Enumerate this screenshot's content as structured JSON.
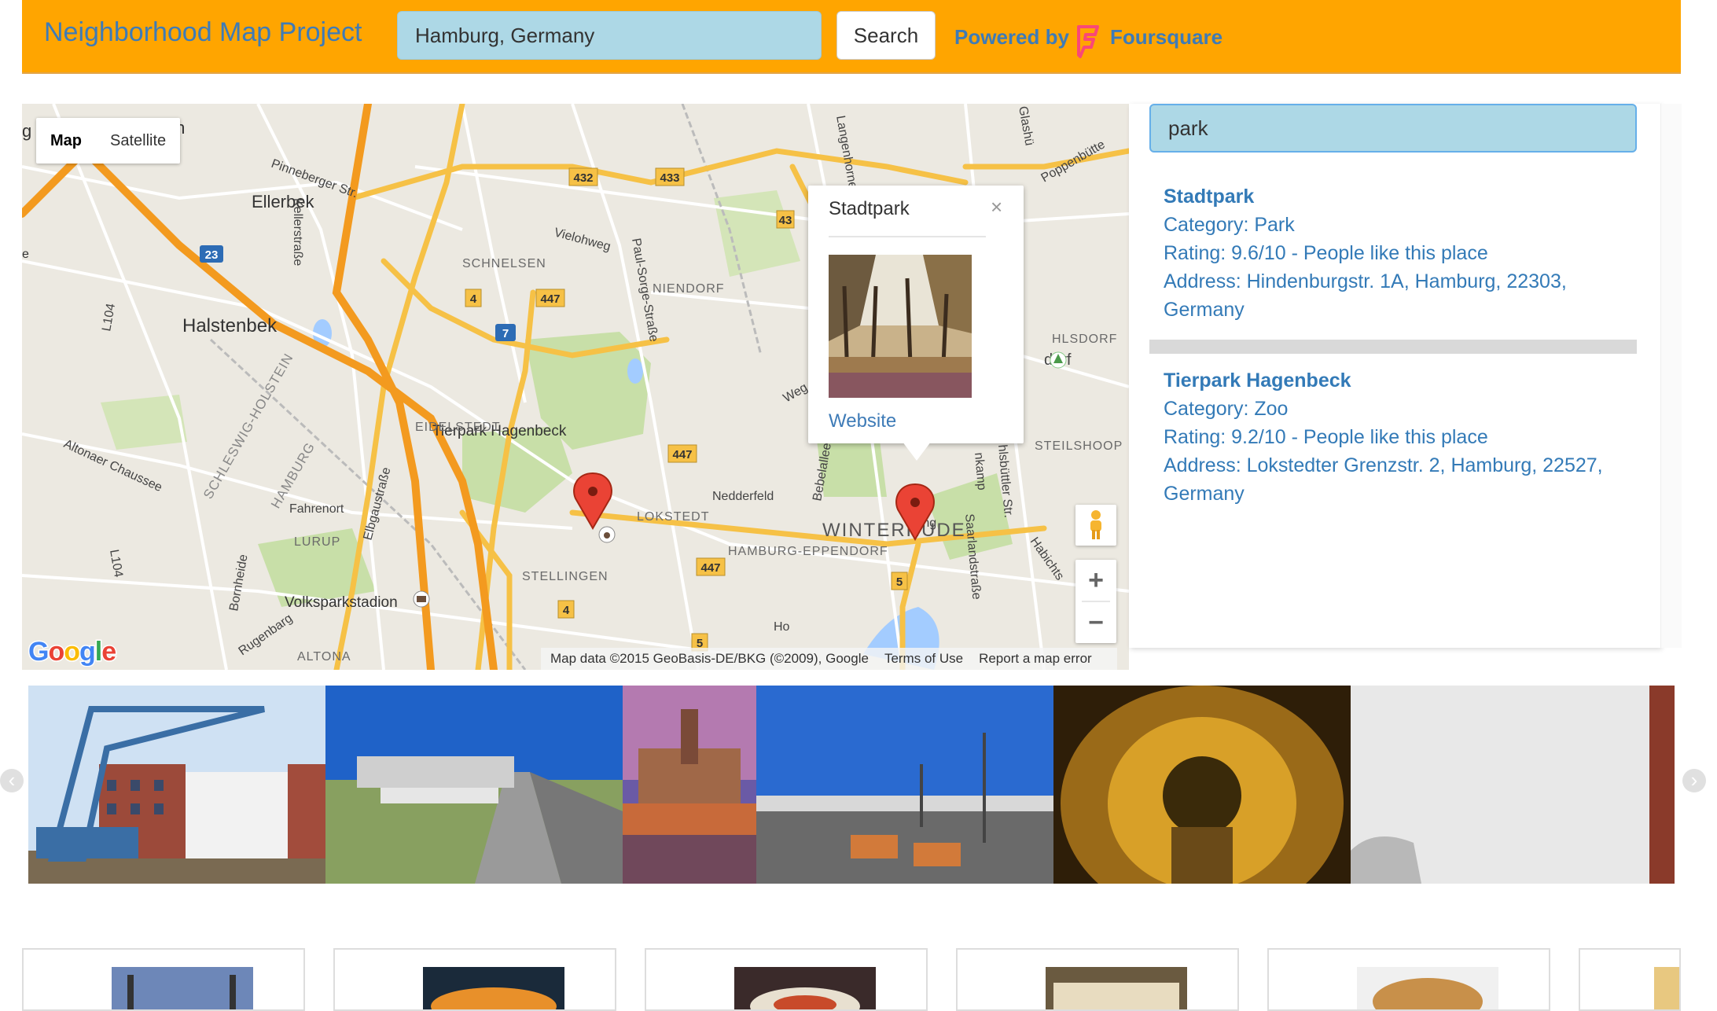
{
  "header": {
    "title": "Neighborhood Map Project",
    "location_value": "Hamburg, Germany",
    "search_label": "Search",
    "powered_by": "Powered by",
    "provider_name": "Foursquare",
    "bg_color": "#ffa500",
    "link_color": "#3e7bb7"
  },
  "map": {
    "type_buttons": [
      "Map",
      "Satellite"
    ],
    "selected_type": "Map",
    "labels": {
      "ellerbek": "Ellerbek",
      "halstenbek": "Halstenbek",
      "schnelsen": "SCHNELSEN",
      "niendorf": "NIENDORF",
      "eidelstedt": "EIDELSTEDT",
      "lokstedt": "LOKSTEDT",
      "stellingen": "STELLINGEN",
      "winterhude": "WINTERHUDE",
      "hamburg_eppendorf": "HAMBURG-EPPENDORF",
      "lurup": "LURUP",
      "altona": "ALTONA",
      "fahrenort": "Fahrenort",
      "tierpark": "Tierpark Hagenbeck",
      "volkspark": "Volksparkstadion",
      "nedderfeld": "Nedderfeld",
      "vielohweg": "Vielohweg",
      "pinneberger": "Pinneberger Str.",
      "kellerstrasse": "Kellerstraße",
      "paul_sorge": "Paul-Sorge-Straße",
      "langenhorner": "Langenhorner",
      "poppenbuttel": "Poppenbütte",
      "glashu": "Glashü",
      "ohlsdorf": "HLSDORF",
      "dorf": "dorf",
      "steilshoop": "STEILSHOOP",
      "altonaer": "Altonaer Chaussee",
      "schleswig": "SCHLESWIG-HOLSTEIN",
      "hamburg_state": "HAMBURG",
      "elbgau": "Elbgaustraße",
      "bornheide": "Bornheide",
      "rugenbarg": "Rugenbarg",
      "bebelallee": "Bebelallee",
      "saarland": "Saarlandstraße",
      "habichts": "Habichts",
      "fuhlsbuttler": "hlsbüttler Str.",
      "nkamp": "nkamp",
      "weg": "Weg",
      "jarrestadt": "Ja  ng",
      "l104a": "L104",
      "l104b": "L104",
      "jen": "jen",
      "g": "g",
      "e": "e",
      "ho": "Ho"
    },
    "road_shields": {
      "r432": "432",
      "r433": "433",
      "r43": "43",
      "r4a": "4",
      "r447a": "447",
      "r447b": "447",
      "r447c": "447",
      "r4b": "4",
      "r5a": "5",
      "r5b": "5",
      "a23": "23",
      "a7": "7"
    },
    "attribution": [
      "Map data ©2015 GeoBasis-DE/BKG (©2009), Google",
      "Terms of Use",
      "Report a map error"
    ],
    "google_logo": "Google",
    "zoom_in": "+",
    "zoom_out": "−"
  },
  "info_window": {
    "title": "Stadtpark",
    "close": "×",
    "link": "Website"
  },
  "sidebar": {
    "filter_value": "park",
    "venues": [
      {
        "name": "Stadtpark",
        "category": "Category: Park",
        "rating": "Rating: 9.6/10 - People like this place",
        "address_line1": "Address: Hindenburgstr. 1A, Hamburg, 22303,",
        "address_line2": "Germany"
      },
      {
        "name": "Tierpark Hagenbeck",
        "category": "Category: Zoo",
        "rating": "Rating: 9.2/10 - People like this place",
        "address_line1": "Address: Lokstedter Grenzstr. 2, Hamburg, 22527,",
        "address_line2": "Germany"
      }
    ]
  },
  "carousel": {
    "prev_icon": "‹",
    "next_icon": "›"
  }
}
